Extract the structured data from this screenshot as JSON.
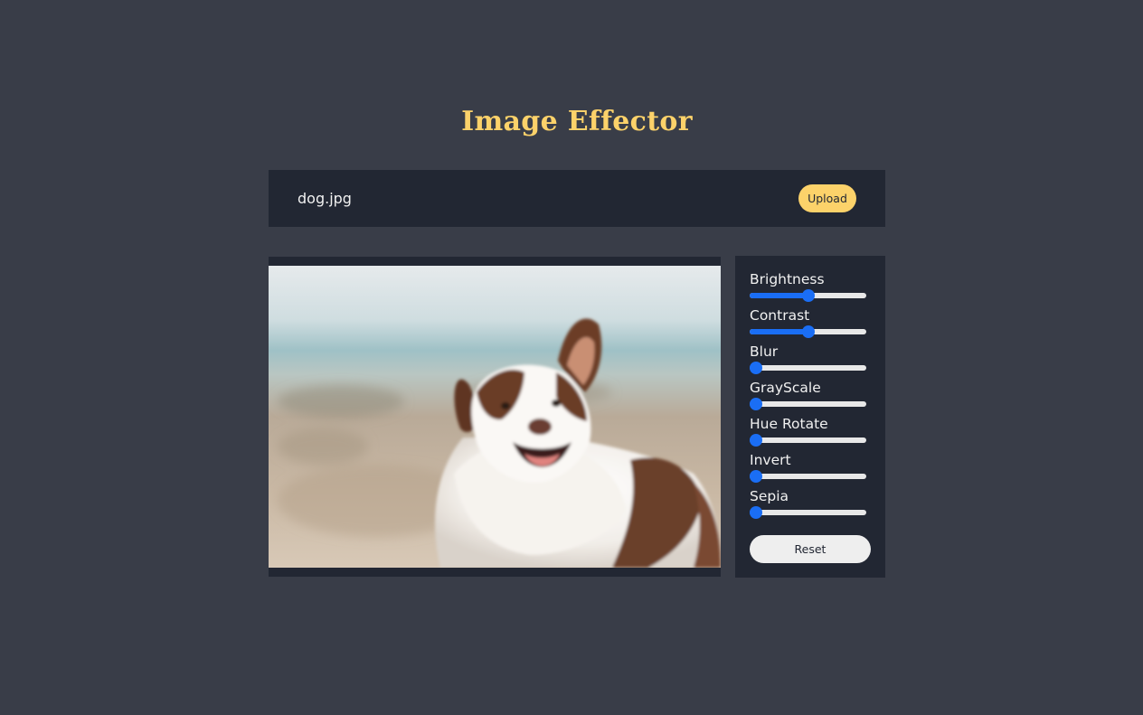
{
  "app": {
    "title": "Image Effector"
  },
  "upload": {
    "file_name": "dog.jpg",
    "button_label": "Upload"
  },
  "image": {
    "subject": "dog-photo"
  },
  "controls": [
    {
      "label": "Brightness",
      "value": 0.5
    },
    {
      "label": "Contrast",
      "value": 0.5
    },
    {
      "label": "Blur",
      "value": 0
    },
    {
      "label": "GrayScale",
      "value": 0
    },
    {
      "label": "Hue Rotate",
      "value": 0
    },
    {
      "label": "Invert",
      "value": 0
    },
    {
      "label": "Sepia",
      "value": 0
    }
  ],
  "reset": {
    "label": "Reset"
  },
  "colors": {
    "background": "#393d48",
    "panel": "#222733",
    "accent": "#fcd26a",
    "slider": "#1a6ef5"
  }
}
